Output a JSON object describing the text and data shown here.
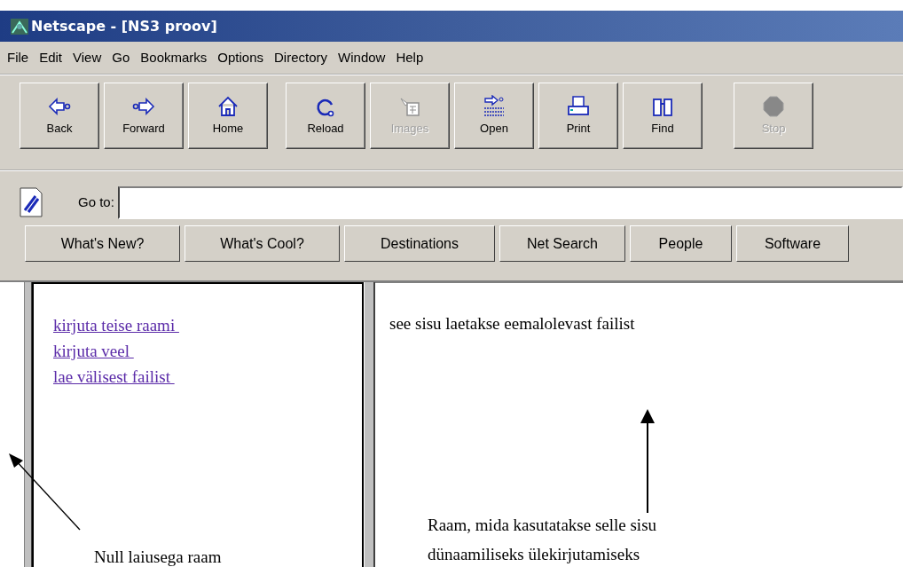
{
  "window": {
    "title": "Netscape - [NS3 proov]"
  },
  "menu": [
    "File",
    "Edit",
    "View",
    "Go",
    "Bookmarks",
    "Options",
    "Directory",
    "Window",
    "Help"
  ],
  "toolbar": [
    [
      {
        "kind": "back",
        "label": "Back",
        "disabled": false
      },
      {
        "kind": "forward",
        "label": "Forward",
        "disabled": false
      },
      {
        "kind": "home",
        "label": "Home",
        "disabled": false
      }
    ],
    [
      {
        "kind": "reload",
        "label": "Reload",
        "disabled": false
      },
      {
        "kind": "images",
        "label": "Images",
        "disabled": true
      },
      {
        "kind": "open",
        "label": "Open",
        "disabled": false
      },
      {
        "kind": "print",
        "label": "Print",
        "disabled": false
      },
      {
        "kind": "find",
        "label": "Find",
        "disabled": false
      }
    ],
    [
      {
        "kind": "stop",
        "label": "Stop",
        "disabled": true
      }
    ]
  ],
  "location": {
    "label": "Go to:"
  },
  "directory_buttons": [
    "What's New?",
    "What's Cool?",
    "Destinations",
    "Net Search",
    "People",
    "Software"
  ],
  "left_frame": {
    "links": [
      "kirjuta teise raami ",
      "kirjuta veel ",
      "lae välisest failist "
    ]
  },
  "right_frame": {
    "text": "see sisu laetakse eemalolevast failist"
  },
  "annotations": [
    {
      "kind": "left",
      "text": "Null laiusega raam"
    },
    {
      "kind": "right",
      "lines": [
        "Raam, mida kasutatakse selle sisu",
        "dünaamiliseks ülekirjutamiseks"
      ]
    }
  ]
}
